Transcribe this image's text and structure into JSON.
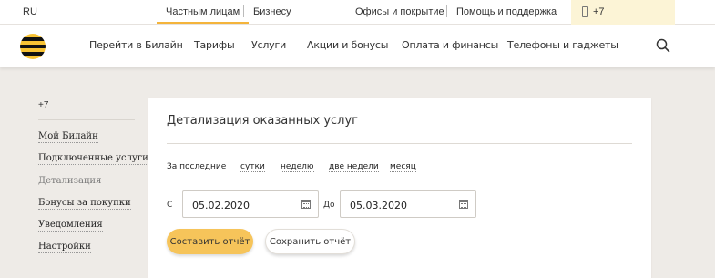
{
  "topbar": {
    "lang": "RU",
    "segments": [
      "Частным лицам",
      "Бизнесу"
    ],
    "links": [
      "Офисы и покрытие",
      "Помощь и поддержка"
    ],
    "phone": "+7"
  },
  "nav": {
    "items": [
      "Перейти в Билайн",
      "Тарифы",
      "Услуги",
      "Акции и бонусы",
      "Оплата и финансы",
      "Телефоны и гаджеты"
    ],
    "search_icon": "search-icon"
  },
  "sidebar": {
    "phone": "+7",
    "items": [
      "Мой Билайн",
      "Подключенные услуги",
      "Детализация",
      "Бонусы за покупки",
      "Уведомления",
      "Настройки"
    ],
    "current_index": 2
  },
  "card": {
    "title": "Детализация оказанных услуг",
    "period_label": "За последние",
    "period_options": [
      "сутки",
      "неделю",
      "две недели",
      "месяц"
    ],
    "from_label": "С",
    "from_value": "05.02.2020",
    "to_label": "До",
    "to_value": "05.03.2020",
    "build_button": "Составить отчёт",
    "save_button": "Сохранить отчёт"
  },
  "colors": {
    "accent": "#f6c45a",
    "background": "#eeebe7"
  }
}
